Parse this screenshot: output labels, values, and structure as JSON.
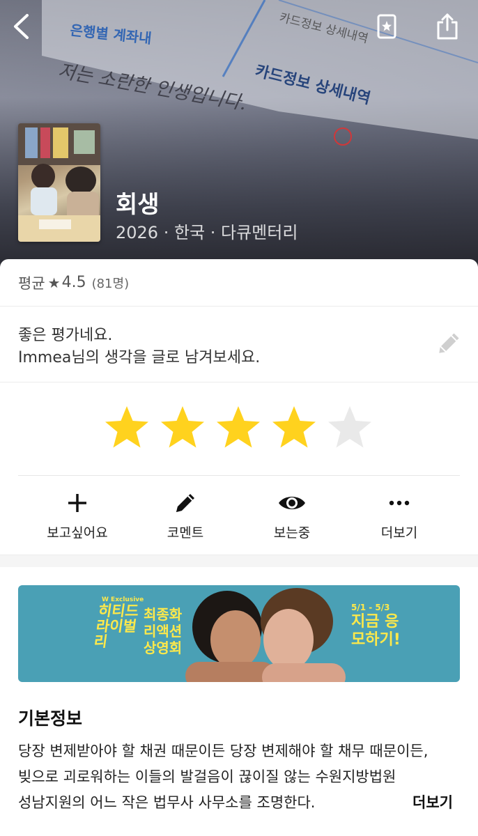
{
  "hero": {
    "title": "회생",
    "subtitle": "2026 · 한국 · 다큐멘터리",
    "background_doc_text": {
      "line1": "은행별 계좌내",
      "line2": "카드정보 상세내역",
      "line3": "카드정보 상세내역",
      "handwriting": "저는 소란한 인생입니다."
    }
  },
  "rating": {
    "avg_label": "평균",
    "avg_star": "★",
    "avg_score": "4.5",
    "avg_count": "(81명)",
    "user_stars": 4,
    "max_stars": 5,
    "filled_color": "#FFD21E",
    "empty_color": "#E9E9E9"
  },
  "comment": {
    "line1": "좋은 평가네요.",
    "line2": "Immea님의 생각을 글로 남겨보세요."
  },
  "actions": [
    {
      "label": "보고싶어요",
      "icon": "plus-icon"
    },
    {
      "label": "코멘트",
      "icon": "pencil-icon"
    },
    {
      "label": "보는중",
      "icon": "eye-icon"
    },
    {
      "label": "더보기",
      "icon": "more-icon"
    }
  ],
  "banner": {
    "brand": "W Exclusive",
    "show": "히티드 라이벌리",
    "event": "최종화 리액션 상영회",
    "date": "5/1 - 5/3",
    "cta": "지금 응모하기!",
    "bg_color": "#4AA0B5",
    "text_color": "#FFE94A"
  },
  "info": {
    "heading": "기본정보",
    "text": "당장 변제받아야 할 채권 때문이든 당장 변제해야 할 채무 때문이든, 빚으로 괴로워하는 이들의 발걸음이 끊이질 않는 수원지방법원 성남지원의 어느 작은 법무사 사무소를 조명한다.",
    "more": "더보기"
  }
}
